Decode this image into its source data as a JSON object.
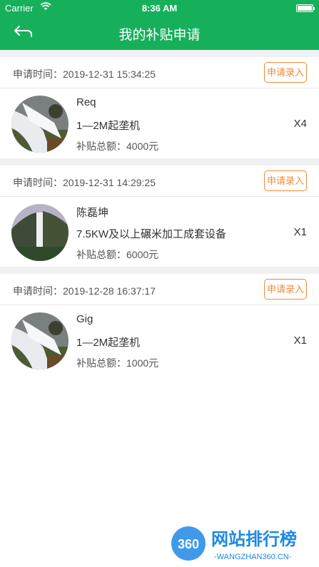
{
  "status_bar": {
    "carrier": "Carrier",
    "time": "8:36 AM"
  },
  "nav": {
    "title": "我的补贴申请",
    "back_icon": "back-arrow-icon"
  },
  "records": [
    {
      "timestamp": "申请时间：2019-12-31 15:34:25",
      "action": "申请录入",
      "name": "Req",
      "product": "1—2M起垄机",
      "quantity": "X4",
      "total": "补贴总额：4000元",
      "image": "waterfall-rocks"
    },
    {
      "timestamp": "申请时间：2019-12-31 14:29:25",
      "action": "申请录入",
      "name": "陈磊坤",
      "product": "7.5KW及以上碾米加工成套设备",
      "quantity": "X1",
      "total": "补贴总额：6000元",
      "image": "waterfall-cliff"
    },
    {
      "timestamp": "申请时间：2019-12-28 16:37:17",
      "action": "申请录入",
      "name": "Gig",
      "product": "1—2M起垄机",
      "quantity": "X1",
      "total": "补贴总额：1000元",
      "image": "waterfall-rocks"
    }
  ],
  "watermark": {
    "badge": "360",
    "title": "网站排行榜",
    "url": "-WANGZHAN360.CN-"
  },
  "colors": {
    "primary": "#16b05a",
    "accent": "#f08a36",
    "divider": "#f0f1f3"
  }
}
